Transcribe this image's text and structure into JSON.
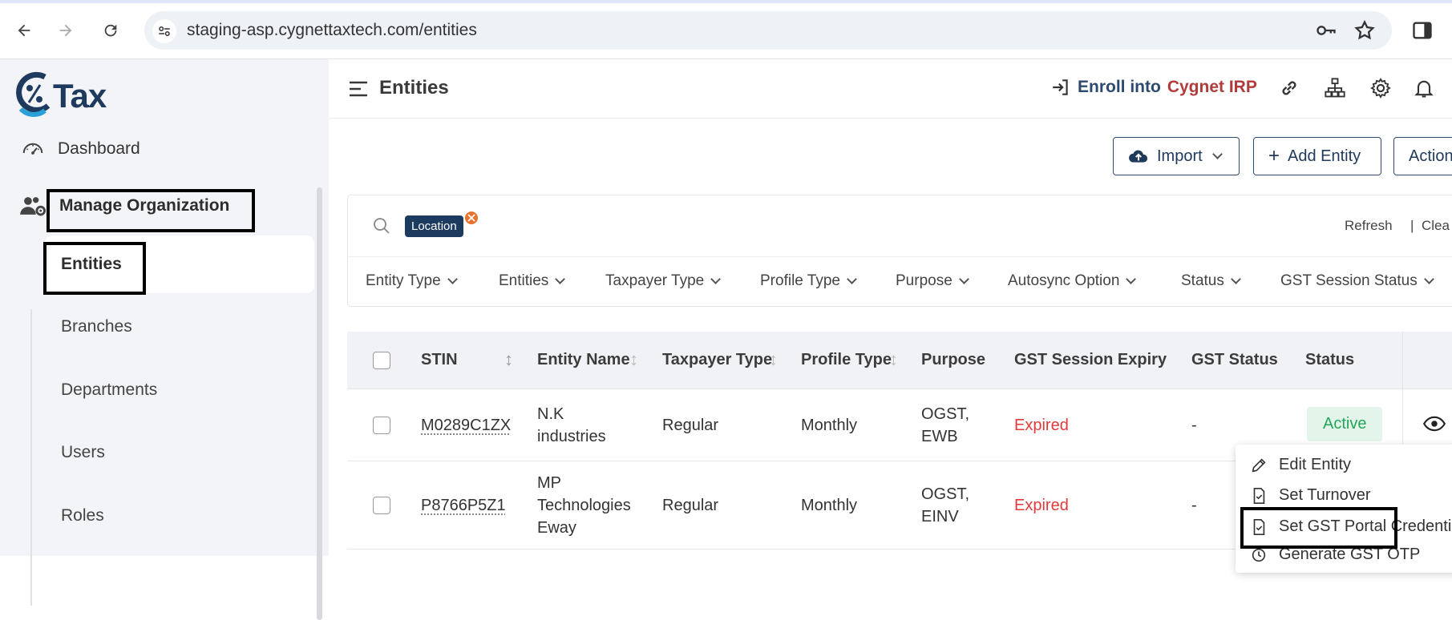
{
  "browser": {
    "url": "staging-asp.cygnettaxtech.com/entities"
  },
  "brand": {
    "logo_text": "Tax"
  },
  "sidebar": {
    "dashboard": "Dashboard",
    "manage_org": "Manage Organization",
    "sub_items": [
      "Entities",
      "Branches",
      "Departments",
      "Users",
      "Roles"
    ]
  },
  "header": {
    "title": "Entities",
    "enroll_prefix": "Enroll into",
    "enroll_brand": "Cygnet IRP"
  },
  "toolbar": {
    "import_label": "Import",
    "add_entity_label": "Add Entity",
    "actions_label": "Action"
  },
  "search": {
    "chip": "Location",
    "refresh": "Refresh",
    "separator": "|",
    "clear": "Clea"
  },
  "filters": [
    "Entity Type",
    "Entities",
    "Taxpayer Type",
    "Profile Type",
    "Purpose",
    "Autosync Option",
    "Status",
    "GST Session Status"
  ],
  "table": {
    "columns": [
      "STIN",
      "Entity Name",
      "Taxpayer Type",
      "Profile Type",
      "Purpose",
      "GST Session Expiry",
      "GST Status",
      "Status"
    ],
    "rows": [
      {
        "gstin": "M0289C1ZX",
        "name_l1": "N.K",
        "name_l2": "industries",
        "name_l3": "",
        "taxpayer": "Regular",
        "profile": "Monthly",
        "purpose_l1": "OGST,",
        "purpose_l2": "EWB",
        "expiry": "Expired",
        "gst_status": "-",
        "status": "Active"
      },
      {
        "gstin": "P8766P5Z1",
        "name_l1": "MP",
        "name_l2": "Technologies",
        "name_l3": "Eway",
        "taxpayer": "Regular",
        "profile": "Monthly",
        "purpose_l1": "OGST,",
        "purpose_l2": "EINV",
        "expiry": "Expired",
        "gst_status": "-",
        "status": ""
      }
    ]
  },
  "row_menu": {
    "items": [
      "Edit Entity",
      "Set Turnover",
      "Set GST Portal Credentia",
      "Generate GST OTP"
    ]
  },
  "colors": {
    "brand_blue": "#2c4a6e",
    "accent_red": "#b03b3b",
    "expired_red": "#e03a3a",
    "active_green": "#25a55a"
  }
}
